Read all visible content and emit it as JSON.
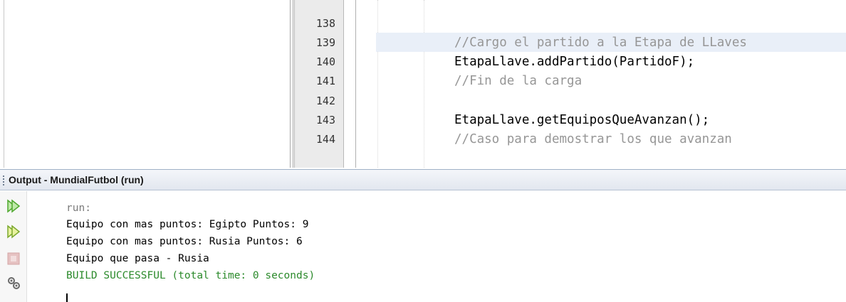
{
  "editor": {
    "lines": [
      {
        "number": "138",
        "text": ""
      },
      {
        "number": "139",
        "text": "//Cargo el partido a la Etapa de LLaves",
        "kind": "comment"
      },
      {
        "number": "140",
        "text": "EtapaLlave.addPartido(PartidoF);",
        "kind": "code"
      },
      {
        "number": "141",
        "text": "//Fin de la carga",
        "kind": "comment"
      },
      {
        "number": "142",
        "text": ""
      },
      {
        "number": "143",
        "text": "EtapaLlave.getEquiposQueAvanzan();",
        "kind": "code"
      },
      {
        "number": "144",
        "text": "//Caso para demostrar los que avanzan",
        "kind": "comment"
      }
    ],
    "highlighted_line": "139"
  },
  "output": {
    "title": "Output - MundialFutbol (run)",
    "toolbar": [
      "run-again-icon",
      "rerun-with-options-icon",
      "stop-icon",
      "settings-icon"
    ],
    "lines": [
      {
        "text": "run:",
        "kind": "muted"
      },
      {
        "text": "Equipo con mas puntos: Egipto Puntos: 9",
        "kind": "normal"
      },
      {
        "text": "Equipo con mas puntos: Rusia Puntos: 6",
        "kind": "normal"
      },
      {
        "text": "Equipo que pasa - Rusia",
        "kind": "normal"
      },
      {
        "text": "BUILD SUCCESSFUL (total time: 0 seconds)",
        "kind": "success"
      }
    ]
  },
  "colors": {
    "comment": "#969696",
    "success": "#2b8a2b",
    "highlight": "#e9eff8",
    "run_icon": "#4fa82e"
  }
}
